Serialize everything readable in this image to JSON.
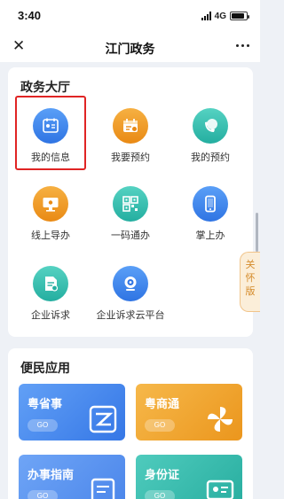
{
  "status_bar": {
    "time": "3:40",
    "network": "4G",
    "battery_level": 0.9
  },
  "nav_bar": {
    "title": "江门政务",
    "close_icon": "close-icon",
    "more_icon": "more-icon"
  },
  "affairs_hall": {
    "title": "政务大厅",
    "items": [
      {
        "label": "我的信息",
        "icon": "id-card-icon",
        "color": "#3b82ec",
        "highlighted": true
      },
      {
        "label": "我要预约",
        "icon": "calendar-icon",
        "color": "#f0a02e"
      },
      {
        "label": "我的预约",
        "icon": "phone-chat-icon",
        "color": "#2fbfb0"
      },
      {
        "label": "线上导办",
        "icon": "monitor-icon",
        "color": "#f0a02e"
      },
      {
        "label": "一码通办",
        "icon": "qr-code-icon",
        "color": "#2fbfb0"
      },
      {
        "label": "掌上办",
        "icon": "smartphone-icon",
        "color": "#3b82ec"
      },
      {
        "label": "企业诉求",
        "icon": "document-icon",
        "color": "#2fbfb0"
      },
      {
        "label": "企业诉求云平台",
        "icon": "webcam-icon",
        "color": "#3b82ec"
      }
    ]
  },
  "convenience": {
    "title": "便民应用",
    "tiles": [
      {
        "title": "粤省事",
        "go": "GO",
        "icon": "yue-logo-icon",
        "color": "#4b8ef0"
      },
      {
        "title": "粤商通",
        "go": "GO",
        "icon": "pinwheel-icon",
        "color": "#f2a531"
      },
      {
        "title": "办事指南",
        "go": "GO",
        "icon": "guide-book-icon",
        "color": "#5e95f2"
      },
      {
        "title": "身份证",
        "go": "GO",
        "icon": "id-card-icon",
        "color": "#39c3b4"
      }
    ]
  },
  "side_tab": {
    "label_1": "关",
    "label_2": "怀",
    "label_3": "版"
  }
}
